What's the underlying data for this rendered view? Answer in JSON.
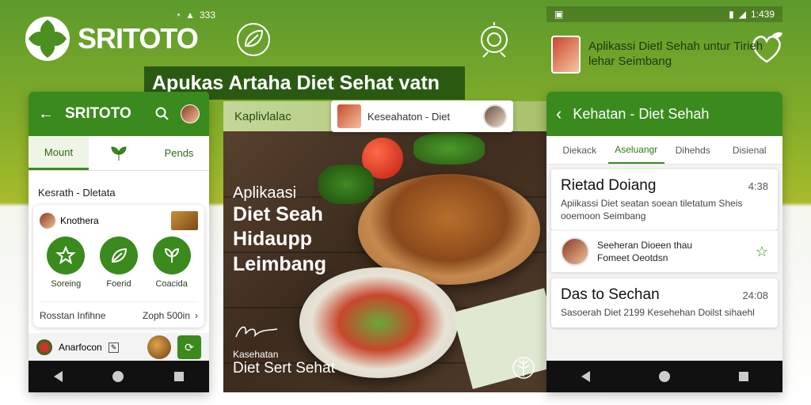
{
  "brand": {
    "name": "SRITOTO"
  },
  "status_left": {
    "icons": [
      "wifi-icon",
      "signal-icon"
    ],
    "time": "333"
  },
  "status_right": {
    "left_icon": "notification-icon",
    "time": "1:439"
  },
  "right_header": {
    "text": "Aplikassi Dietl Sehah untur Tirieh lehar Seimbang"
  },
  "headline": {
    "text": "Apukas Artaha Diet Sehat vatn"
  },
  "left_phone": {
    "appbar_title": "SRITOTO",
    "tabs": [
      {
        "label": "Mount"
      },
      {
        "icon": "leaf-icon"
      },
      {
        "label": "Pends"
      }
    ],
    "section_label": "Kesrath - Dletata",
    "card": {
      "user_label": "Knothera",
      "categories": [
        {
          "label": "Soreing",
          "icon": "star-icon"
        },
        {
          "label": "Foerid",
          "icon": "leaf-icon"
        },
        {
          "label": "Coacida",
          "icon": "plant-icon"
        }
      ],
      "footer_left": "Rosstan Infihne",
      "footer_right": "Zoph 500in"
    },
    "mini_row": {
      "label": "Anarfocon"
    }
  },
  "center_panel": {
    "top_strip": "Kaplivlalac",
    "pill_text": "Keseahaton - Diet",
    "overlay_small": "Aplikaasi",
    "overlay_lines": [
      "Diet Seah",
      "Hidaupp",
      "Leimbang"
    ],
    "bottom_small": "Kasehatan",
    "bottom_big": "Diet Sert Sehat"
  },
  "right_phone": {
    "appbar_title": "Kehatan - Diet Sehah",
    "tabs": [
      "Diekack",
      "Aseluangr",
      "Dihehds",
      "Disienal"
    ],
    "active_tab_index": 1,
    "card1": {
      "title": "Rietad Doiang",
      "time": "4:38",
      "subtitle": "Apiikassi Diet seatan soean tiletatum Sheis ooemoon Seimbang"
    },
    "sub_item": {
      "line1": "Seeheran Dioeen thau",
      "line2": "Fomeet Oeotdsn"
    },
    "card2": {
      "title": "Das to Sechan",
      "time": "24:08",
      "subtitle": "Sasoerah Diet 2199 Kesehehan Doilst sihaehl"
    }
  },
  "colors": {
    "primary_green": "#3a8a1e",
    "dark_green": "#2a5a12",
    "lime": "#a7bb2c"
  }
}
